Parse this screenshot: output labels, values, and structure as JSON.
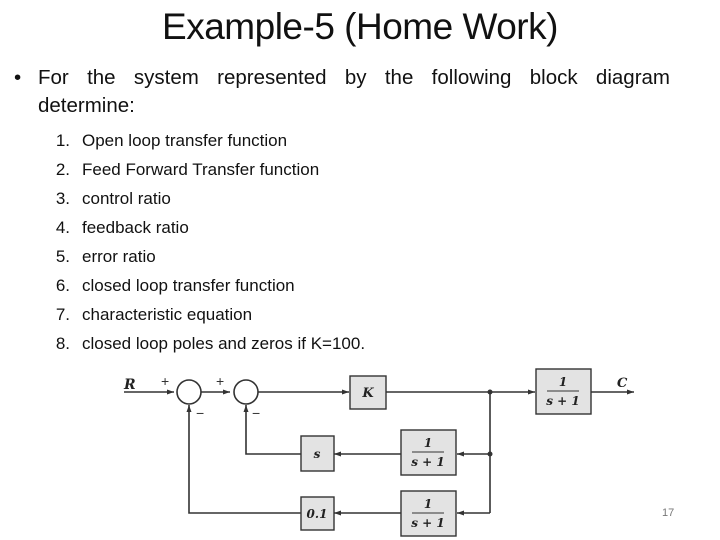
{
  "slide": {
    "title": "Example-5 (Home Work)",
    "bullet_marker": "•",
    "bullet_line1": "For the system represented by the following block diagram",
    "bullet_line2": "determine:",
    "items": [
      {
        "num": "1.",
        "text": "Open loop transfer function"
      },
      {
        "num": "2.",
        "text": "Feed Forward Transfer function"
      },
      {
        "num": "3.",
        "text": "control ratio"
      },
      {
        "num": "4.",
        "text": "feedback ratio"
      },
      {
        "num": "5.",
        "text": "error ratio"
      },
      {
        "num": "6.",
        "text": "closed loop transfer function"
      },
      {
        "num": "7.",
        "text": "characteristic equation"
      },
      {
        "num": "8.",
        "text": "closed loop poles and zeros if K=100."
      }
    ],
    "page_number": "17"
  },
  "diagram": {
    "input_label": "R",
    "output_label": "C",
    "sum1_signs": {
      "in": "+",
      "fb": "−"
    },
    "sum2_signs": {
      "in": "+",
      "fb": "−"
    },
    "forward_gain": "K",
    "plant": {
      "num": "1",
      "den": "s + 1"
    },
    "feedback_inner_filter": {
      "num": "1",
      "den": "s + 1"
    },
    "feedback_inner_gain": "s",
    "feedback_outer_filter": {
      "num": "1",
      "den": "s + 1"
    },
    "feedback_outer_gain": "0.1"
  }
}
